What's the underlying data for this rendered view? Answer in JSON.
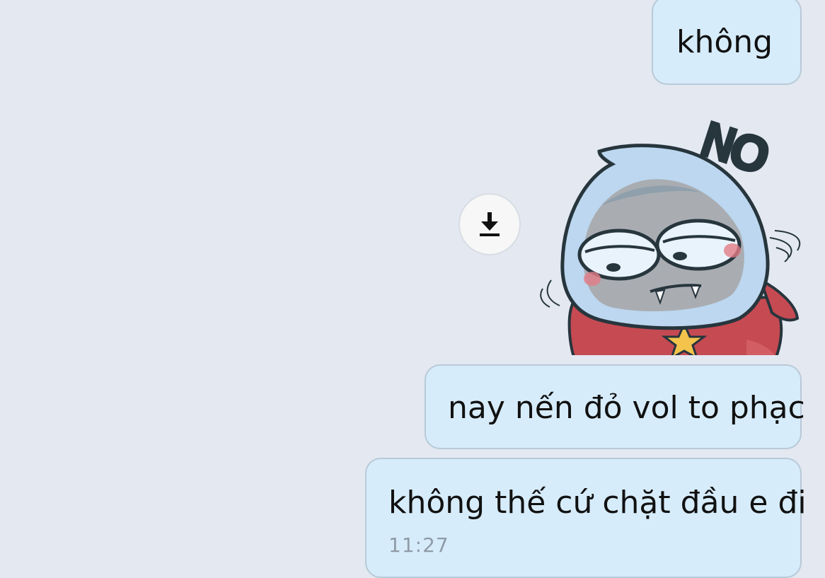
{
  "chat": {
    "messages": [
      {
        "text": "không"
      },
      {
        "sticker": "no-shark-sticker"
      },
      {
        "text": "nay nến đỏ vol to phạc"
      },
      {
        "text": "không thế cứ chặt đầu e đi",
        "time": "11:27"
      }
    ]
  },
  "sticker": {
    "caption": "NO",
    "icon": "download-icon"
  },
  "colors": {
    "background": "#e3e8f1",
    "bubble": "#d7ecfa",
    "bubble_border": "#b7cad8",
    "timestamp": "#8f9ba7"
  }
}
